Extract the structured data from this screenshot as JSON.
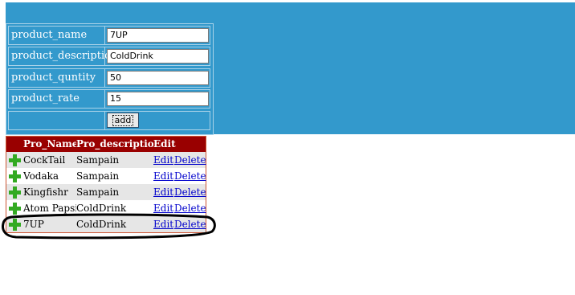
{
  "form": {
    "fields": [
      {
        "label": "product_name",
        "value": "7UP"
      },
      {
        "label": "product_description",
        "value": "ColdDrink"
      },
      {
        "label": "product_quntity",
        "value": "50"
      },
      {
        "label": "product_rate",
        "value": "15"
      }
    ],
    "add_label": "add"
  },
  "grid": {
    "headers": {
      "name": "Pro_Name",
      "desc": "Pro_description",
      "edit": "Edit"
    },
    "rows": [
      {
        "name": "CockTail",
        "desc": "Sampain",
        "edit": "Edit",
        "delete": "Delete"
      },
      {
        "name": "Vodaka",
        "desc": "Sampain",
        "edit": "Edit",
        "delete": "Delete"
      },
      {
        "name": "Kingfishr",
        "desc": "Sampain",
        "edit": "Edit",
        "delete": "Delete"
      },
      {
        "name": "Atom Papsi",
        "desc": "ColdDrink",
        "edit": "Edit",
        "delete": "Delete"
      },
      {
        "name": "7UP",
        "desc": "ColdDrink",
        "edit": "Edit",
        "delete": "Delete"
      }
    ]
  },
  "colors": {
    "band": "#3399cc",
    "header": "#990000",
    "plus": "#33aa22",
    "link": "#0000cc"
  },
  "icons": {
    "row_icon": "plus-icon"
  }
}
